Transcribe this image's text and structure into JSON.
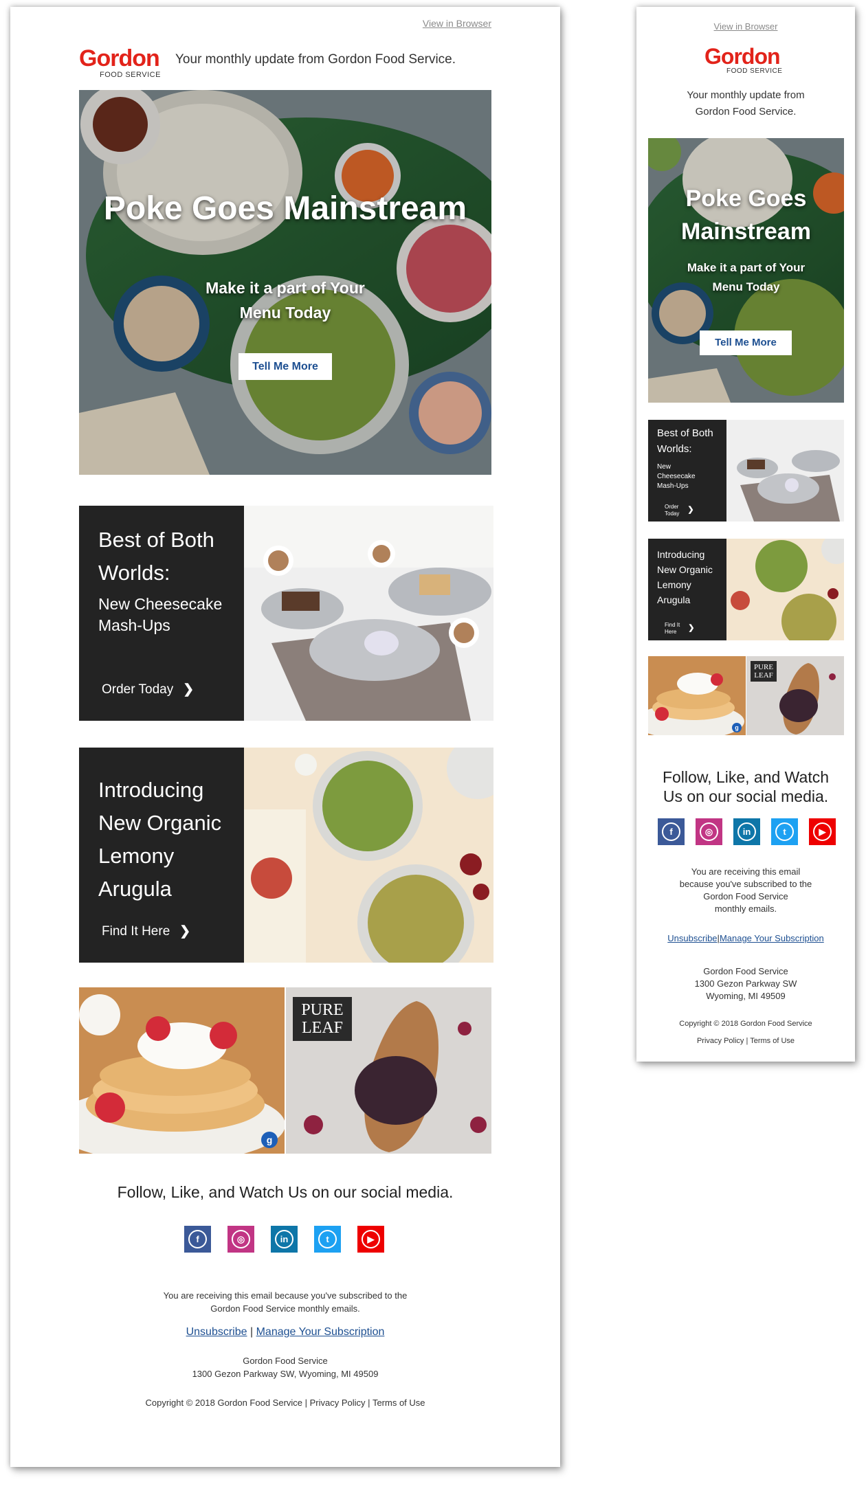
{
  "colors": {
    "brand_red": "#e2231a",
    "link_blue": "#1d4f91",
    "dark_panel": "#232323",
    "facebook": "#3b5998",
    "instagram": "#c13584",
    "linkedin": "#0e76a8",
    "twitter": "#1da1f2",
    "youtube": "#ee0000"
  },
  "header": {
    "view_in_browser": "View in Browser",
    "logo_word": "Gordon",
    "logo_sub": "FOOD SERVICE",
    "tagline": "Your monthly update from Gordon Food Service."
  },
  "hero": {
    "title": "Poke Goes Mainstream",
    "subtitle_line1": "Make it a part of Your",
    "subtitle_line2": "Menu Today",
    "button": "Tell Me More"
  },
  "promos": [
    {
      "title_line1": "Best of Both",
      "title_line2": "Worlds:",
      "subtitle_line1": "New Cheesecake",
      "subtitle_line2": "Mash-Ups",
      "cta": "Order Today",
      "cta_mobile_line1": "Order",
      "cta_mobile_line2": "Today",
      "mobile_sub_line1": "New",
      "mobile_sub_line2": "Cheesecake",
      "mobile_sub_line3": "Mash-Ups"
    },
    {
      "title_line1": "Introducing",
      "title_line2": "New Organic",
      "title_line3": "Lemony",
      "title_line4": "Arugula",
      "cta": "Find It Here",
      "cta_mobile_line1": "Find It",
      "cta_mobile_line2": "Here"
    }
  ],
  "brand_tile": {
    "pure_leaf_line1": "PURE",
    "pure_leaf_line2": "LEAF"
  },
  "social": {
    "heading": "Follow, Like, and Watch Us on our social media.",
    "heading_mobile_line1": "Follow, Like, and Watch",
    "heading_mobile_line2": "Us on our social media.",
    "icons": [
      {
        "name": "facebook-icon",
        "glyph": "f"
      },
      {
        "name": "instagram-icon",
        "glyph": "◎"
      },
      {
        "name": "linkedin-icon",
        "glyph": "in"
      },
      {
        "name": "twitter-icon",
        "glyph": "t"
      },
      {
        "name": "youtube-icon",
        "glyph": "▶"
      }
    ]
  },
  "footer": {
    "receiving_line1": "You are receiving this email because you've subscribed to the",
    "receiving_line2": "Gordon Food Service monthly emails.",
    "receiving_mobile_line1": "You are receiving this email",
    "receiving_mobile_line2": "because you've subscribed to the",
    "receiving_mobile_line3": "Gordon Food Service",
    "receiving_mobile_line4": "monthly emails.",
    "unsubscribe": "Unsubscribe",
    "separator": "|",
    "manage": "Manage Your Subscription",
    "company": "Gordon Food Service",
    "address": "1300 Gezon Parkway SW, Wyoming, MI 49509",
    "address_mobile_line1": "1300 Gezon Parkway SW",
    "address_mobile_line2": "Wyoming, MI 49509",
    "copyright": "Copyright © 2018 Gordon Food Service",
    "privacy": "Privacy Policy",
    "terms": "Terms of Use"
  }
}
